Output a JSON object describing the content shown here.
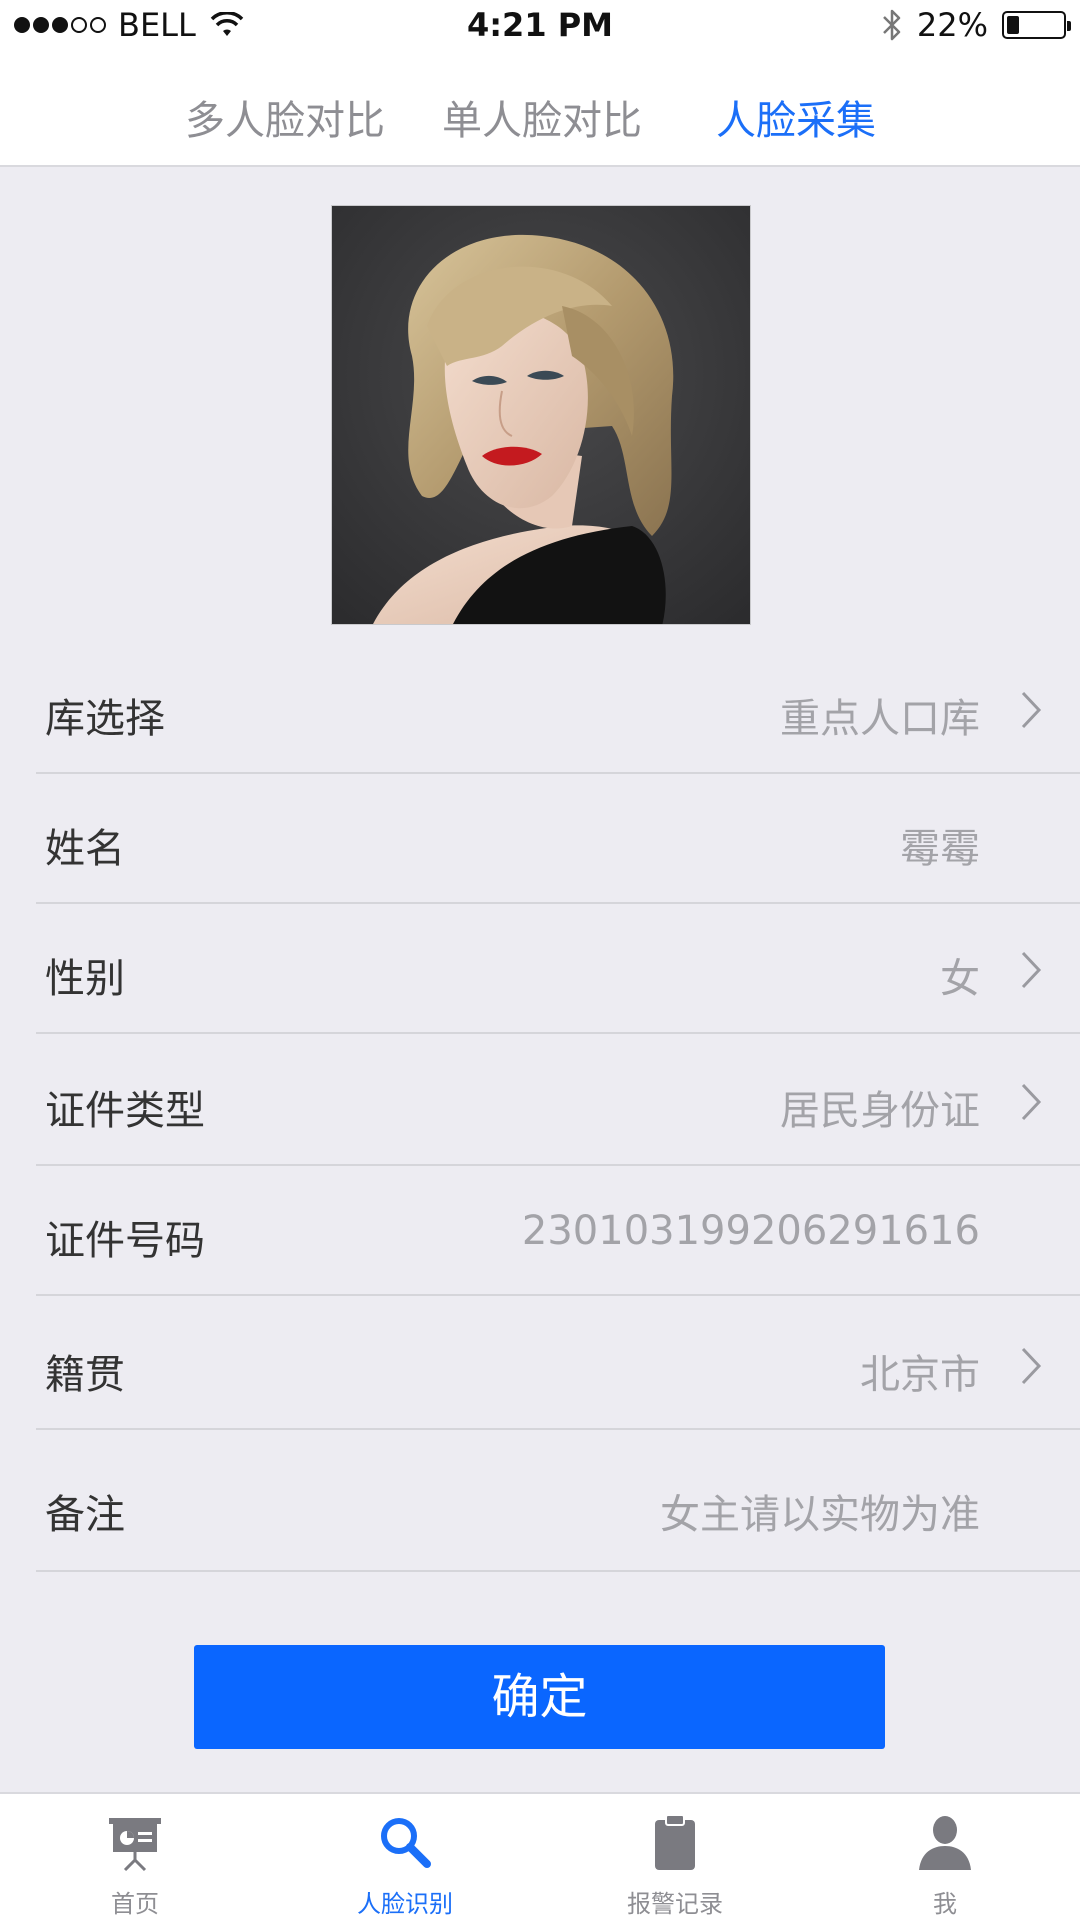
{
  "status_bar": {
    "carrier": "BELL",
    "time": "4:21 PM",
    "battery": "22%",
    "battery_level": 0.22,
    "signal_bars_filled": 3,
    "signal_bars_total": 5
  },
  "top_tabs": {
    "items": [
      {
        "label": "多人脸对比",
        "active": false
      },
      {
        "label": "单人脸对比",
        "active": false
      },
      {
        "label": "人脸采集",
        "active": true
      }
    ],
    "active_color": "#1b6ff8"
  },
  "form": {
    "rows": [
      {
        "label": "库选择",
        "value": "重点人口库",
        "has_chevron": true
      },
      {
        "label": "姓名",
        "value": "霉霉",
        "has_chevron": false
      },
      {
        "label": "性别",
        "value": "女",
        "has_chevron": true
      },
      {
        "label": "证件类型",
        "value": "居民身份证",
        "has_chevron": true
      },
      {
        "label": "证件号码",
        "value": "230103199206291616",
        "has_chevron": false
      },
      {
        "label": "籍贯",
        "value": "北京市",
        "has_chevron": true
      },
      {
        "label": "备注",
        "value": "女主请以实物为准",
        "has_chevron": false
      }
    ]
  },
  "confirm_label": "确定",
  "tabbar": {
    "items": [
      {
        "label": "首页",
        "icon": "presentation-board-icon",
        "active": false
      },
      {
        "label": "人脸识别",
        "icon": "search-icon",
        "active": true
      },
      {
        "label": "报警记录",
        "icon": "clipboard-icon",
        "active": false
      },
      {
        "label": "我",
        "icon": "user-icon",
        "active": false
      }
    ]
  },
  "colors": {
    "accent": "#1b6ff8",
    "button": "#0a66ff",
    "background": "#edecf2"
  }
}
